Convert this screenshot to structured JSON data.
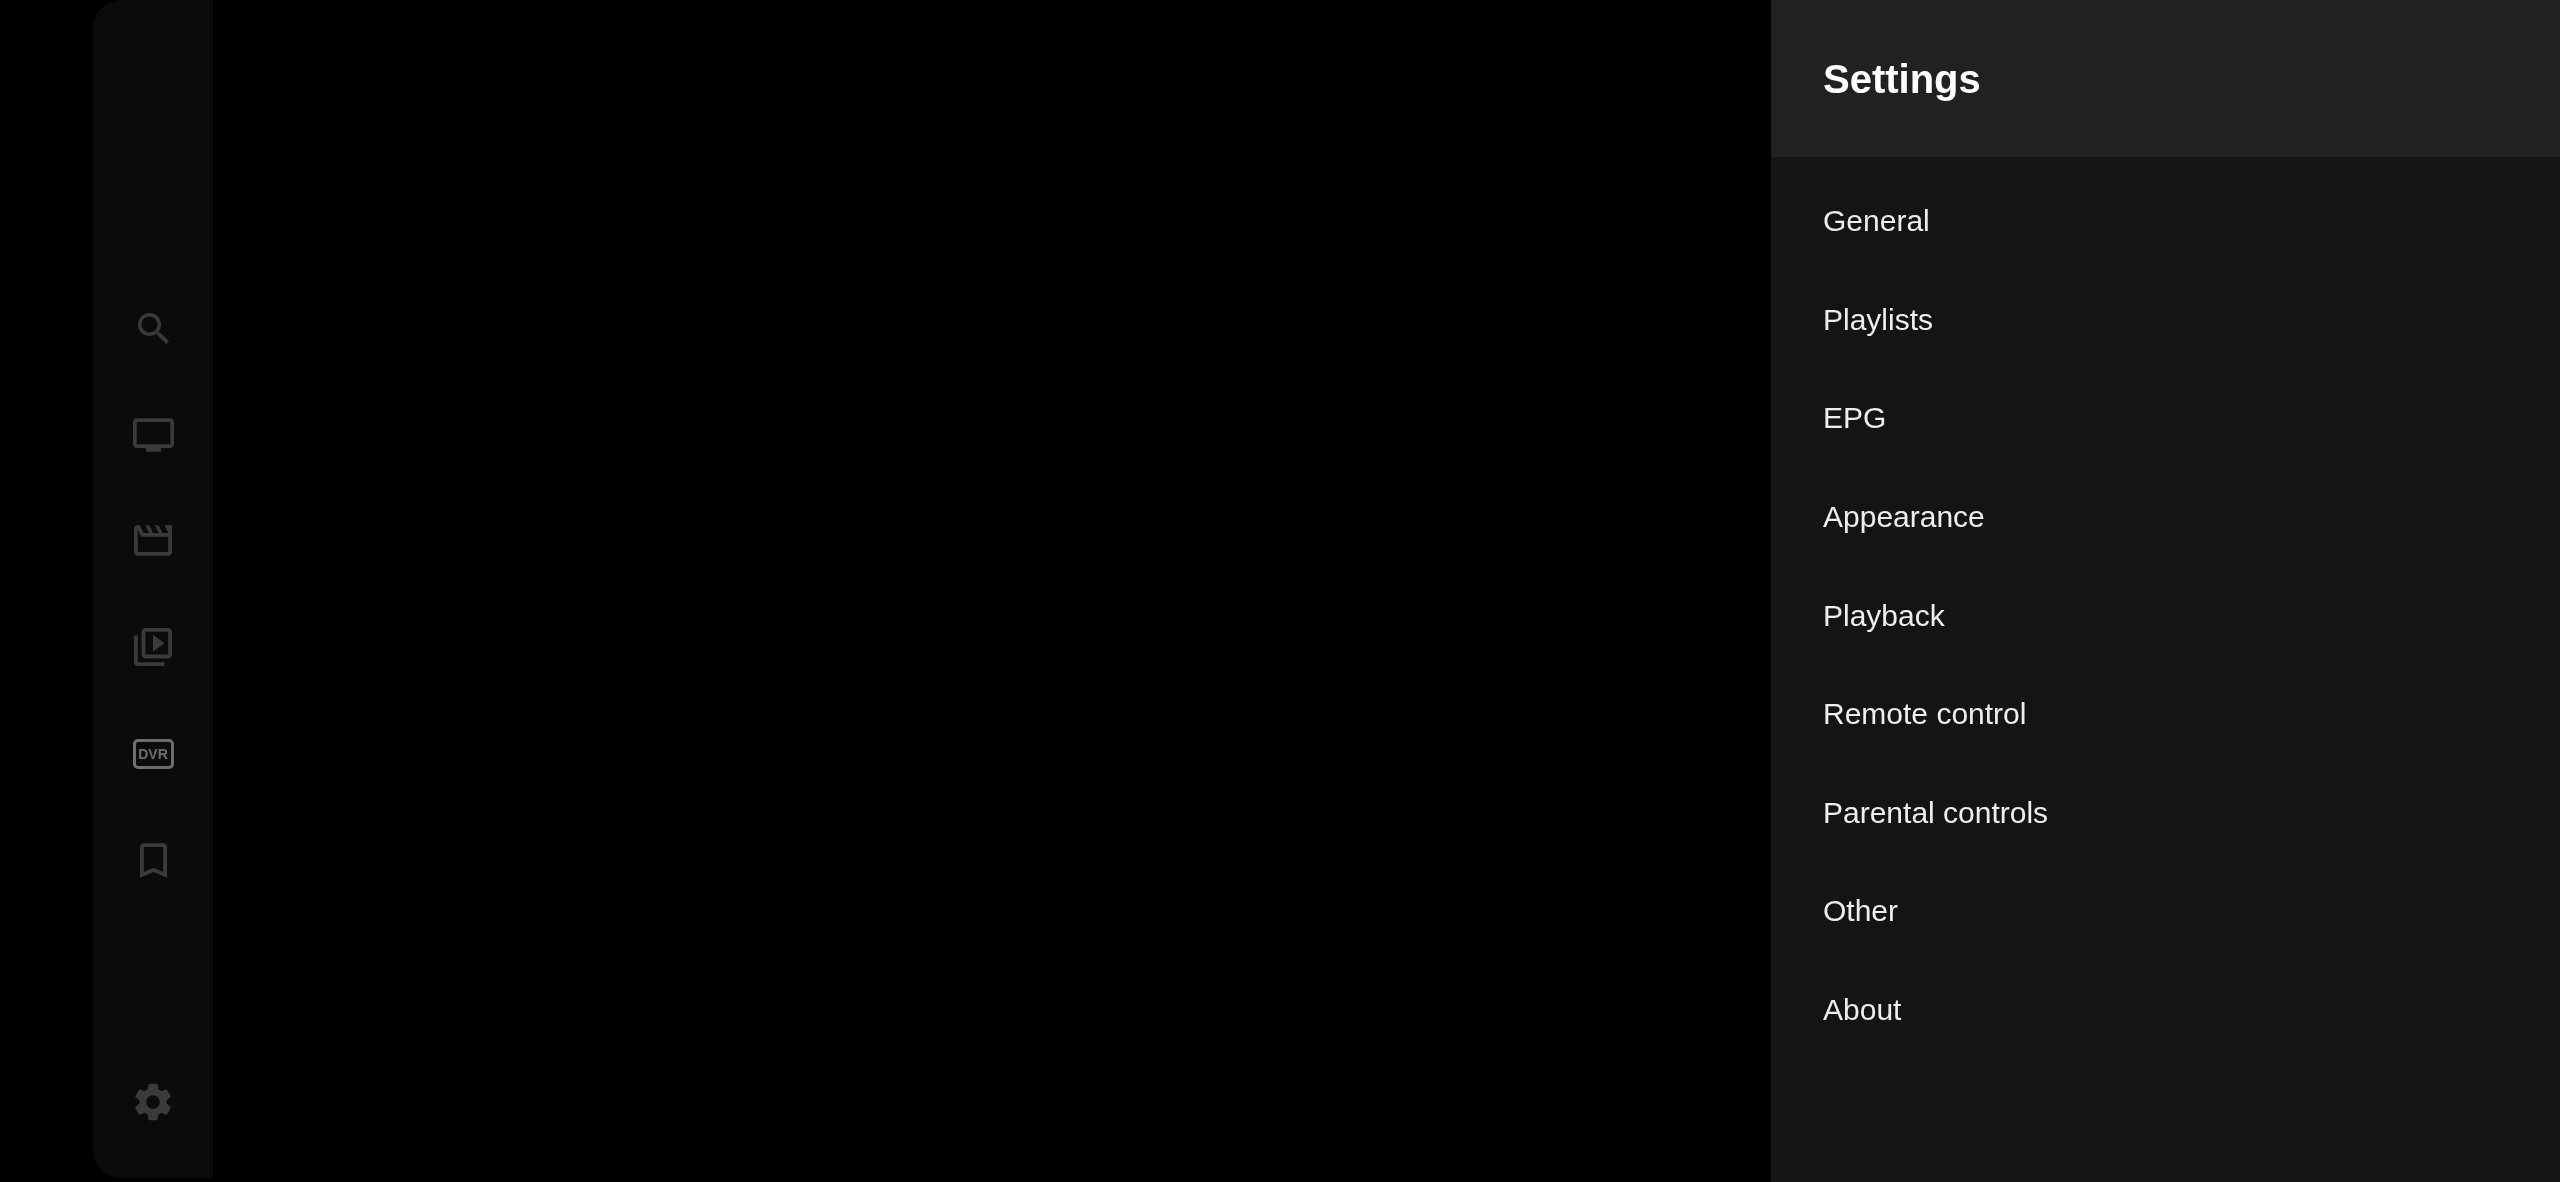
{
  "sidebar": {
    "items": [
      {
        "kind": "search",
        "selected": false
      },
      {
        "kind": "tv",
        "selected": false
      },
      {
        "kind": "clapper",
        "selected": false
      },
      {
        "kind": "library",
        "selected": false
      },
      {
        "kind": "label",
        "label": "DVR",
        "selected": true
      },
      {
        "kind": "bookmark",
        "selected": false
      }
    ]
  },
  "settings": {
    "title": "Settings",
    "items": [
      {
        "label": "General"
      },
      {
        "label": "Playlists"
      },
      {
        "label": "EPG"
      },
      {
        "label": "Appearance"
      },
      {
        "label": "Playback"
      },
      {
        "label": "Remote control"
      },
      {
        "label": "Parental controls"
      },
      {
        "label": "Other"
      },
      {
        "label": "About"
      }
    ]
  }
}
